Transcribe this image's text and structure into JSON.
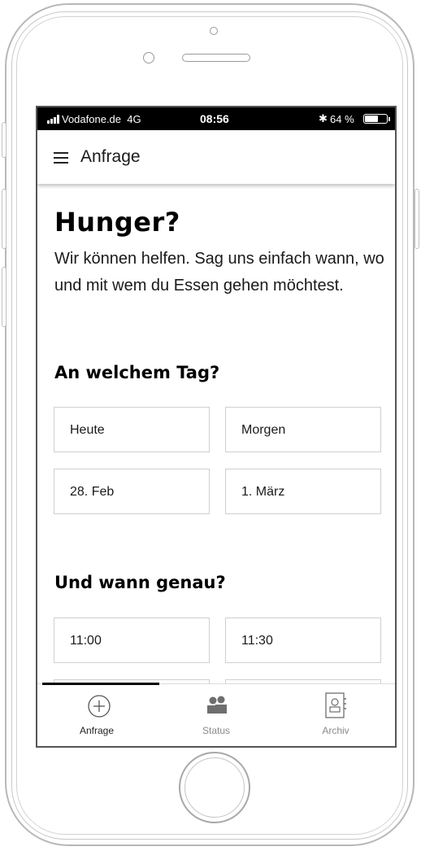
{
  "status_bar": {
    "carrier": "Vodafone.de",
    "network": "4G",
    "time": "08:56",
    "bluetooth": "✱",
    "battery_text": "64 %",
    "battery_level": 0.64
  },
  "app_bar": {
    "title": "Anfrage",
    "menu_icon": "hamburger-menu-icon"
  },
  "hero": {
    "title": "Hunger?",
    "text": "Wir können helfen. Sag uns einfach wann, wo und mit wem du Essen gehen möchtest."
  },
  "day_section": {
    "title": "An welchem Tag?",
    "options": [
      "Heute",
      "Morgen",
      "28. Feb",
      "1. März"
    ]
  },
  "time_section": {
    "title": "Und wann genau?",
    "options": [
      "11:00",
      "11:30"
    ]
  },
  "tab_bar": {
    "active": "Anfrage",
    "tabs": [
      {
        "label": "Anfrage",
        "icon": "plus-circle-icon",
        "color": "#222222"
      },
      {
        "label": "Status",
        "icon": "people-icon",
        "color": "#8a8a8a"
      },
      {
        "label": "Archiv",
        "icon": "archive-contact-icon",
        "color": "#8a8a8a"
      }
    ]
  }
}
